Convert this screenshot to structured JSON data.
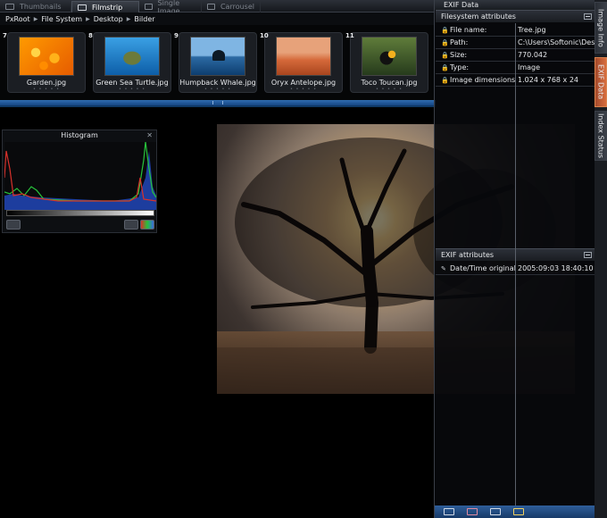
{
  "tabs": [
    {
      "label": "Thumbnails",
      "active": false
    },
    {
      "label": "Filmstrip",
      "active": true
    },
    {
      "label": "Single Image",
      "active": false
    },
    {
      "label": "Carrousel",
      "active": false
    }
  ],
  "breadcrumb": [
    "PxRoot",
    "File System",
    "Desktop",
    "Bilder"
  ],
  "filmstrip": {
    "items": [
      {
        "number": "7",
        "caption": "Garden.jpg",
        "thumb": "garden"
      },
      {
        "number": "8",
        "caption": "Green Sea Turtle.jpg",
        "thumb": "turtle"
      },
      {
        "number": "9",
        "caption": "Humpback Whale.jpg",
        "thumb": "whale"
      },
      {
        "number": "10",
        "caption": "Oryx Antelope.jpg",
        "thumb": "oryx"
      },
      {
        "number": "11",
        "caption": "Toco Toucan.jpg",
        "thumb": "toucan"
      }
    ],
    "rating_glyphs": "• • • • •"
  },
  "histogram": {
    "title": "Histogram",
    "close_glyph": "✕",
    "channel_colors": {
      "red": "#d8312b",
      "green": "#27c33b",
      "blue": "#3b6be0"
    }
  },
  "exif_panel": {
    "title": "EXIF Data",
    "filesystem_header": "Filesystem attributes",
    "filesystem_rows": [
      {
        "key": "File name:",
        "value": "Tree.jpg"
      },
      {
        "key": "Path:",
        "value": "C:\\Users\\Softonic\\Desktop"
      },
      {
        "key": "Size:",
        "value": "770.042"
      },
      {
        "key": "Type:",
        "value": "Image"
      },
      {
        "key": "Image dimensions",
        "value": "1.024 x 768 x 24"
      }
    ],
    "exif_header": "EXIF attributes",
    "exif_rows": [
      {
        "key": "Date/Time original",
        "value": "2005:09:03 18:40:10"
      }
    ],
    "lock_glyph": "🔒",
    "edit_glyph": "✎"
  },
  "side_tabs": [
    {
      "label": "Image Info",
      "active": false
    },
    {
      "label": "EXIF Data",
      "active": true
    },
    {
      "label": "Index Status",
      "active": false
    }
  ],
  "colors": {
    "accent_blue": "#1d4f8a",
    "active_side_tab": "#d86e3f"
  }
}
